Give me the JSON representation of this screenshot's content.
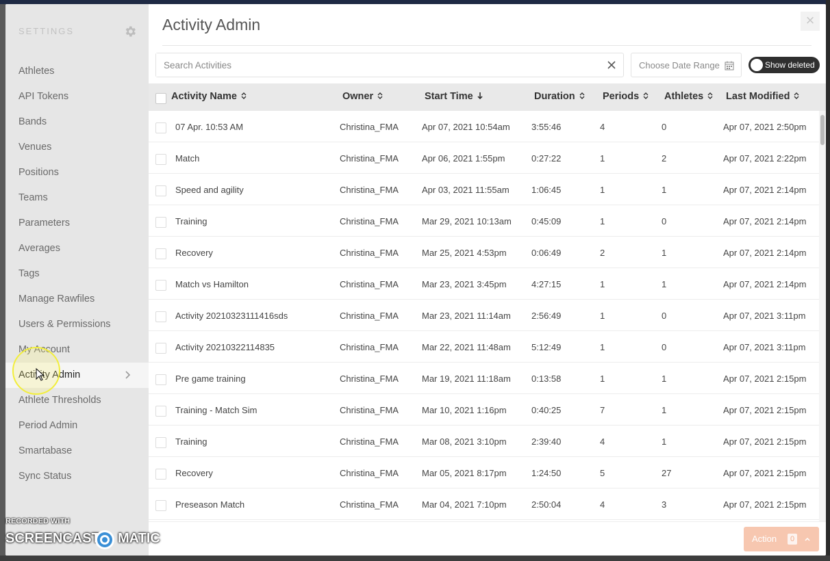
{
  "sidebar": {
    "title": "SETTINGS",
    "items": [
      {
        "label": "Athletes"
      },
      {
        "label": "API Tokens"
      },
      {
        "label": "Bands"
      },
      {
        "label": "Venues"
      },
      {
        "label": "Positions"
      },
      {
        "label": "Teams"
      },
      {
        "label": "Parameters"
      },
      {
        "label": "Averages"
      },
      {
        "label": "Tags"
      },
      {
        "label": "Manage Rawfiles"
      },
      {
        "label": "Users & Permissions"
      },
      {
        "label": "My Account"
      },
      {
        "label": "Activity Admin",
        "active": true
      },
      {
        "label": "Athlete Thresholds"
      },
      {
        "label": "Period Admin"
      },
      {
        "label": "Smartabase"
      },
      {
        "label": "Sync Status"
      }
    ]
  },
  "main": {
    "title": "Activity Admin",
    "close_symbol": "×",
    "search": {
      "placeholder": "Search Activities",
      "value": ""
    },
    "date_range": {
      "placeholder": "Choose Date Range"
    },
    "show_deleted": {
      "label": "Show deleted",
      "on": false
    },
    "columns": [
      "Activity Name",
      "Owner",
      "Start Time",
      "Duration",
      "Periods",
      "Athletes",
      "Last Modified"
    ],
    "sorted_column": "Start Time",
    "sort_direction": "descending",
    "rows": [
      {
        "name": "07 Apr. 10:53 AM",
        "owner": "Christina_FMA",
        "start": "Apr 07, 2021 10:54am",
        "duration": "3:55:46",
        "periods": "4",
        "athletes": "0",
        "modified": "Apr 07, 2021 2:50pm"
      },
      {
        "name": "Match",
        "owner": "Christina_FMA",
        "start": "Apr 06, 2021 1:55pm",
        "duration": "0:27:22",
        "periods": "1",
        "athletes": "2",
        "modified": "Apr 07, 2021 2:22pm"
      },
      {
        "name": "Speed and agility",
        "owner": "Christina_FMA",
        "start": "Apr 03, 2021 11:55am",
        "duration": "1:06:45",
        "periods": "1",
        "athletes": "1",
        "modified": "Apr 07, 2021 2:14pm"
      },
      {
        "name": "Training",
        "owner": "Christina_FMA",
        "start": "Mar 29, 2021 10:13am",
        "duration": "0:45:09",
        "periods": "1",
        "athletes": "0",
        "modified": "Apr 07, 2021 2:14pm"
      },
      {
        "name": "Recovery",
        "owner": "Christina_FMA",
        "start": "Mar 25, 2021 4:53pm",
        "duration": "0:06:49",
        "periods": "2",
        "athletes": "1",
        "modified": "Apr 07, 2021 2:14pm"
      },
      {
        "name": "Match vs Hamilton",
        "owner": "Christina_FMA",
        "start": "Mar 23, 2021 3:45pm",
        "duration": "4:27:15",
        "periods": "1",
        "athletes": "1",
        "modified": "Apr 07, 2021 2:14pm"
      },
      {
        "name": "Activity 20210323111416sds",
        "owner": "Christina_FMA",
        "start": "Mar 23, 2021 11:14am",
        "duration": "2:56:49",
        "periods": "1",
        "athletes": "0",
        "modified": "Apr 07, 2021 3:11pm"
      },
      {
        "name": "Activity 20210322114835",
        "owner": "Christina_FMA",
        "start": "Mar 22, 2021 11:48am",
        "duration": "5:12:49",
        "periods": "1",
        "athletes": "0",
        "modified": "Apr 07, 2021 3:11pm"
      },
      {
        "name": "Pre game training",
        "owner": "Christina_FMA",
        "start": "Mar 19, 2021 11:18am",
        "duration": "0:13:58",
        "periods": "1",
        "athletes": "1",
        "modified": "Apr 07, 2021 2:15pm"
      },
      {
        "name": "Training - Match Sim",
        "owner": "Christina_FMA",
        "start": "Mar 10, 2021 1:16pm",
        "duration": "0:40:25",
        "periods": "7",
        "athletes": "1",
        "modified": "Apr 07, 2021 2:15pm"
      },
      {
        "name": "Training",
        "owner": "Christina_FMA",
        "start": "Mar 08, 2021 3:10pm",
        "duration": "2:39:40",
        "periods": "4",
        "athletes": "1",
        "modified": "Apr 07, 2021 2:15pm"
      },
      {
        "name": "Recovery",
        "owner": "Christina_FMA",
        "start": "Mar 05, 2021 8:17pm",
        "duration": "1:24:50",
        "periods": "5",
        "athletes": "27",
        "modified": "Apr 07, 2021 2:15pm"
      },
      {
        "name": "Preseason Match",
        "owner": "Christina_FMA",
        "start": "Mar 04, 2021 7:10pm",
        "duration": "2:50:04",
        "periods": "4",
        "athletes": "3",
        "modified": "Apr 07, 2021 2:15pm"
      }
    ],
    "action_button": {
      "label": "Action",
      "count": "0"
    }
  },
  "watermark": {
    "line1": "RECORDED WITH",
    "left": "SCREENCAST",
    "right": "MATIC"
  },
  "icons": {
    "settings": "gear-icon",
    "nav_active": "chevron-right-icon",
    "search_clear": "close-icon",
    "date": "calendar-icon",
    "sort": "sort-icon",
    "sort_active": "arrow-down-icon"
  },
  "colors": {
    "sidebar_bg": "#e6e6e6",
    "header_bg": "#e9e9e9",
    "toggle_bg": "#2f2f2f",
    "action_bg": "#f7c7b0",
    "highlight_ring": "#f2ee3a"
  }
}
